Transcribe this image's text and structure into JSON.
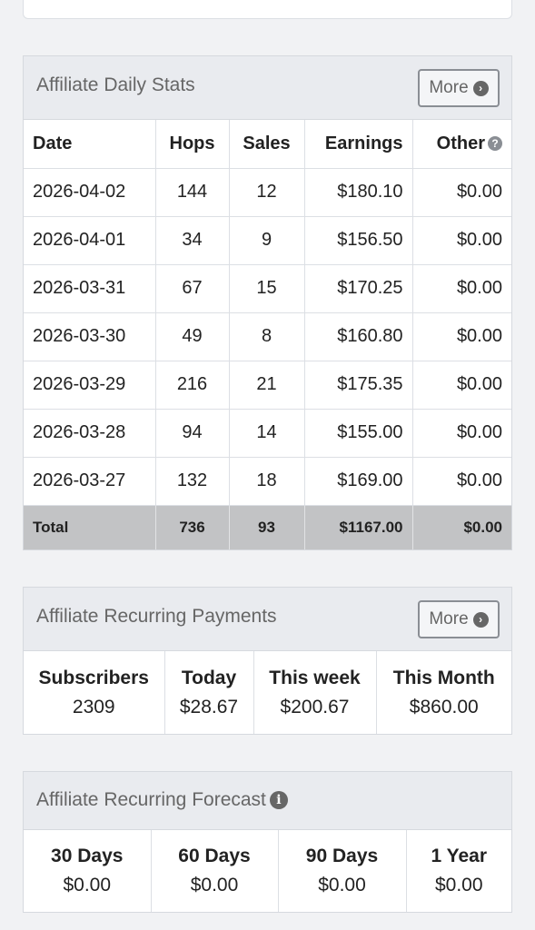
{
  "daily_stats": {
    "title": "Affiliate Daily Stats",
    "more_label": "More",
    "columns": [
      "Date",
      "Hops",
      "Sales",
      "Earnings",
      "Other"
    ],
    "rows": [
      [
        "2026-04-02",
        "144",
        "12",
        "$180.10",
        "$0.00"
      ],
      [
        "2026-04-01",
        "34",
        "9",
        "$156.50",
        "$0.00"
      ],
      [
        "2026-03-31",
        "67",
        "15",
        "$170.25",
        "$0.00"
      ],
      [
        "2026-03-30",
        "49",
        "8",
        "$160.80",
        "$0.00"
      ],
      [
        "2026-03-29",
        "216",
        "21",
        "$175.35",
        "$0.00"
      ],
      [
        "2026-03-28",
        "94",
        "14",
        "$155.00",
        "$0.00"
      ],
      [
        "2026-03-27",
        "132",
        "18",
        "$169.00",
        "$0.00"
      ]
    ],
    "total": [
      "Total",
      "736",
      "93",
      "$1167.00",
      "$0.00"
    ]
  },
  "recurring_payments": {
    "title": "Affiliate Recurring Payments",
    "more_label": "More",
    "items": [
      {
        "label": "Subscribers",
        "value": "2309"
      },
      {
        "label": "Today",
        "value": "$28.67"
      },
      {
        "label": "This week",
        "value": "$200.67"
      },
      {
        "label": "This Month",
        "value": "$860.00"
      }
    ]
  },
  "recurring_forecast": {
    "title": "Affiliate Recurring Forecast",
    "items": [
      {
        "label": "30 Days",
        "value": "$0.00"
      },
      {
        "label": "60 Days",
        "value": "$0.00"
      },
      {
        "label": "90 Days",
        "value": "$0.00"
      },
      {
        "label": "1 Year",
        "value": "$0.00"
      }
    ]
  },
  "icons": {
    "more": "chevron-circle-right-icon",
    "other_help": "question-circle-icon",
    "forecast_info": "info-circle-icon"
  }
}
